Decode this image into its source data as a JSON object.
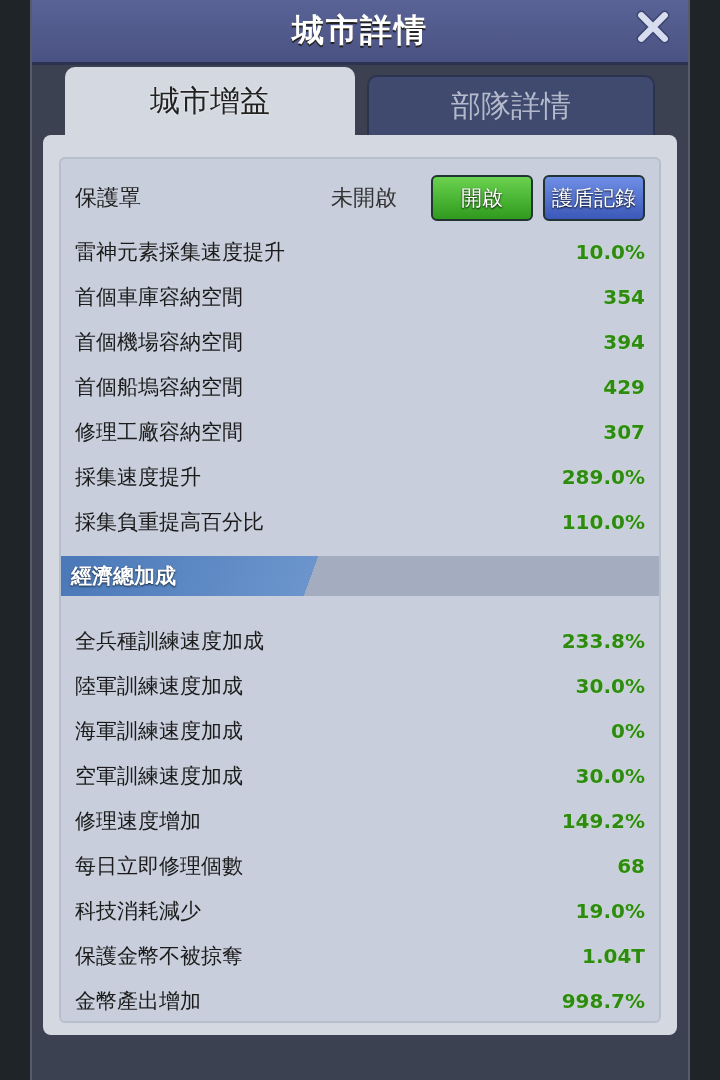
{
  "window": {
    "title": "城市詳情"
  },
  "tabs": [
    {
      "label": "城市增益",
      "selected": true
    },
    {
      "label": "部隊詳情",
      "selected": false
    }
  ],
  "shield": {
    "label": "保護罩",
    "status": "未開啟",
    "buttons": [
      {
        "label": "開啟",
        "kind": "green"
      },
      {
        "label": "護盾記錄",
        "kind": "blue"
      }
    ]
  },
  "stats": [
    {
      "label": "雷神元素採集速度提升",
      "value": "10.0%"
    },
    {
      "label": "首個車庫容納空間",
      "value": "354"
    },
    {
      "label": "首個機場容納空間",
      "value": "394"
    },
    {
      "label": "首個船塢容納空間",
      "value": "429"
    },
    {
      "label": "修理工廠容納空間",
      "value": "307"
    },
    {
      "label": "採集速度提升",
      "value": "289.0%"
    },
    {
      "label": "採集負重提高百分比",
      "value": "110.0%"
    }
  ],
  "economy": {
    "title": "經濟總加成",
    "rows": [
      {
        "label": "全兵種訓練速度加成",
        "value": "233.8%"
      },
      {
        "label": "陸軍訓練速度加成",
        "value": "30.0%"
      },
      {
        "label": "海軍訓練速度加成",
        "value": "0%"
      },
      {
        "label": "空軍訓練速度加成",
        "value": "30.0%"
      },
      {
        "label": "修理速度增加",
        "value": "149.2%"
      },
      {
        "label": "每日立即修理個數",
        "value": "68"
      },
      {
        "label": "科技消耗減少",
        "value": "19.0%"
      },
      {
        "label": "保護金幣不被掠奪",
        "value": "1.04T"
      },
      {
        "label": "金幣產出增加",
        "value": "998.7%"
      }
    ]
  }
}
